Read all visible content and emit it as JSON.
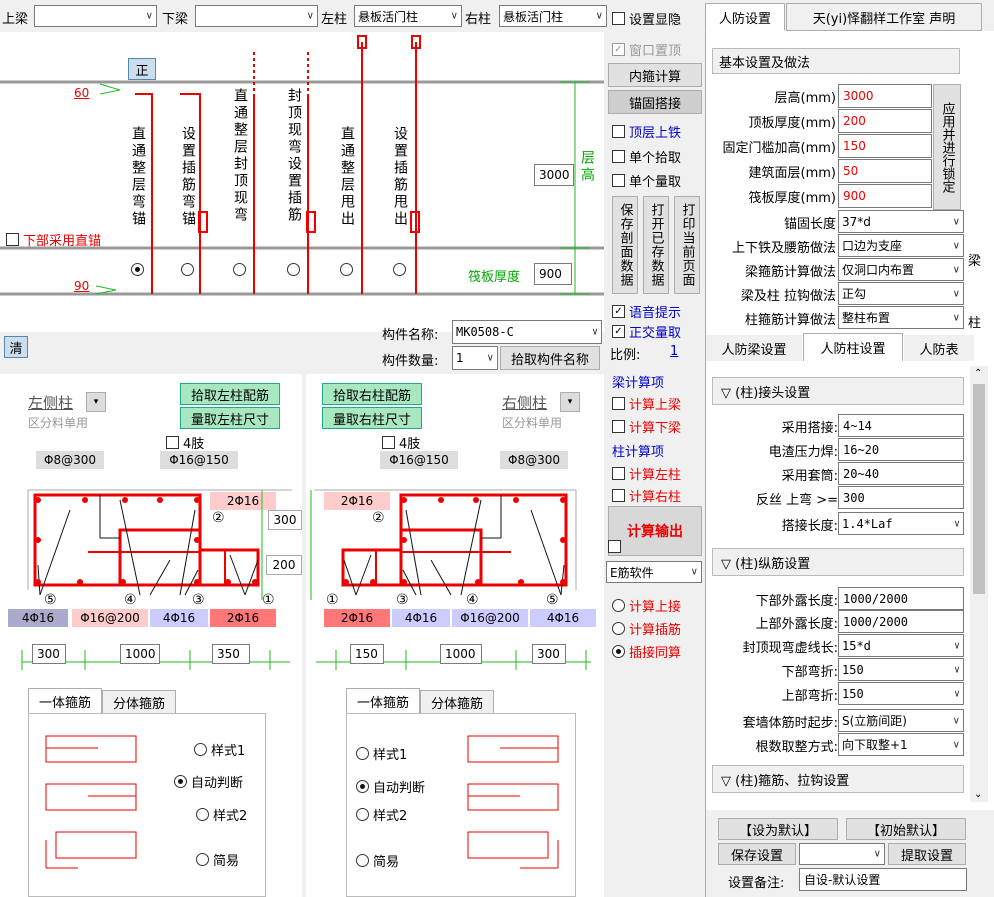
{
  "top": {
    "beam_up_label": "上梁",
    "beam_down_label": "下梁",
    "col_left_label": "左柱",
    "col_left_value": "悬板活门柱",
    "col_right_label": "右柱",
    "col_right_value": "悬板活门柱",
    "show_hide": "设置显隐",
    "tab_rf": "人防设置",
    "tab_studio": "天(yi)怿翻样工作室 声明"
  },
  "diagram": {
    "zheng": "正",
    "dim60": "60",
    "dim90": "90",
    "height_val": "3000",
    "height_label": "层高",
    "floor_label": "筏板厚度",
    "floor_val": "900",
    "bottom_straight": "下部采用直锚",
    "options": [
      "直通整层弯锚",
      "设置插筋弯锚",
      "直通整层封顶现弯",
      "封顶现弯设置插筋",
      "直通整层甩出",
      "设置插筋甩出"
    ],
    "selected": 0
  },
  "mid": {
    "topmost": "窗口置顶",
    "inner_calc": "内箍计算",
    "anchor_lap": "锚固搭接",
    "top_iron": "顶层上铁",
    "single_pick": "单个拾取",
    "single_measure": "单个量取",
    "save_section": "保存剖面数据",
    "open_saved": "打开已存数据",
    "print_page": "打印当前页面",
    "voice": "语音提示",
    "ortho": "正交量取",
    "scale_label": "比例:",
    "scale_val": "1",
    "beam_items": "梁计算项",
    "calc_up_beam": "计算上梁",
    "calc_down_beam": "计算下梁",
    "col_items": "柱计算项",
    "calc_left_col": "计算左柱",
    "calc_right_col": "计算右柱",
    "calc_output": "计算输出",
    "soft": "E筋软件",
    "r_up": "计算上接",
    "r_ins": "计算插筋",
    "r_same": "插接同算"
  },
  "comp": {
    "name_label": "构件名称:",
    "name_val": "MK0508-C",
    "count_label": "构件数量:",
    "count_val": "1",
    "pick_name": "拾取构件名称",
    "clear": "清"
  },
  "left_col": {
    "title": "左侧柱",
    "sub": "区分料单用",
    "pick": "拾取左柱配筋",
    "measure": "量取左柱尺寸",
    "four": "4肢",
    "s1": "Φ8@300",
    "s2": "Φ16@150",
    "s3": "2Φ16",
    "d300": "300",
    "d200": "200",
    "n5": "⑤",
    "n4": "④",
    "n3": "③",
    "n2": "②",
    "n1": "①",
    "b5": "4Φ16",
    "b4": "Φ16@200",
    "b3": "4Φ16",
    "b1": "2Φ16",
    "w1": "300",
    "w2": "1000",
    "w3": "350",
    "tab1": "一体箍筋",
    "tab2": "分体箍筋",
    "st1": "样式1",
    "st2": "自动判断",
    "st3": "样式2",
    "st4": "简易"
  },
  "right_col": {
    "title": "右侧柱",
    "sub": "区分料单用",
    "pick": "拾取右柱配筋",
    "measure": "量取右柱尺寸",
    "four": "4肢",
    "s1": "Φ8@300",
    "s2": "Φ16@150",
    "s3": "2Φ16",
    "n1": "①",
    "n2": "②",
    "n3": "③",
    "n4": "④",
    "n5": "⑤",
    "b1": "2Φ16",
    "b3": "4Φ16",
    "b4": "Φ16@200",
    "b5": "4Φ16",
    "w1": "150",
    "w2": "1000",
    "w3": "300",
    "tab1": "一体箍筋",
    "tab2": "分体箍筋",
    "st1": "样式1",
    "st2": "自动判断",
    "st3": "样式2",
    "st4": "简易"
  },
  "right": {
    "basic": "基本设置及做法",
    "apply": "应用并进行锁定",
    "rows": [
      {
        "k": "层高(mm)",
        "v": "3000"
      },
      {
        "k": "顶板厚度(mm)",
        "v": "200"
      },
      {
        "k": "固定门槛加高(mm)",
        "v": "150"
      },
      {
        "k": "建筑面层(mm)",
        "v": "50"
      },
      {
        "k": "筏板厚度(mm)",
        "v": "900"
      }
    ],
    "selrows": [
      {
        "k": "锚固长度",
        "v": "37*d"
      },
      {
        "k": "上下铁及腰筋做法",
        "v": "口边为支座"
      },
      {
        "k": "梁箍筋计算做法",
        "v": "仅洞口内布置"
      },
      {
        "k": "梁及柱 拉钩做法",
        "v": "正勾"
      },
      {
        "k": "柱箍筋计算做法",
        "v": "整柱布置"
      }
    ],
    "side_beam": "梁",
    "side_col": "柱",
    "tab_beam": "人防梁设置",
    "tab_col": "人防柱设置",
    "tab_tbl": "人防表",
    "sec1": "▽ (柱)接头设置",
    "j": [
      {
        "k": "采用搭接:",
        "v": "4~14"
      },
      {
        "k": "电渣压力焊:",
        "v": "16~20"
      },
      {
        "k": "采用套筒:",
        "v": "20~40"
      },
      {
        "k": "反丝 上弯 >=",
        "v": "300"
      }
    ],
    "lap_k": "搭接长度:",
    "lap_v": "1.4*Laf",
    "sec2": "▽ (柱)纵筋设置",
    "z": [
      {
        "k": "下部外露长度:",
        "v": "1000/2000"
      },
      {
        "k": "上部外露长度:",
        "v": "1000/2000"
      },
      {
        "k": "封顶现弯虚线长:",
        "v": "15*d"
      },
      {
        "k": "下部弯折:",
        "v": "150"
      },
      {
        "k": "上部弯折:",
        "v": "150"
      },
      {
        "k": "套墙体筋时起步:",
        "v": "S(立筋间距)"
      },
      {
        "k": "根数取整方式:",
        "v": "向下取整+1"
      }
    ],
    "sec3": "▽ (柱)箍筋、拉钩设置",
    "set_default": "【设为默认】",
    "init_default": "【初始默认】",
    "save_set": "保存设置",
    "get_set": "提取设置",
    "note_k": "设置备注:",
    "note_v": "自设-默认设置"
  }
}
